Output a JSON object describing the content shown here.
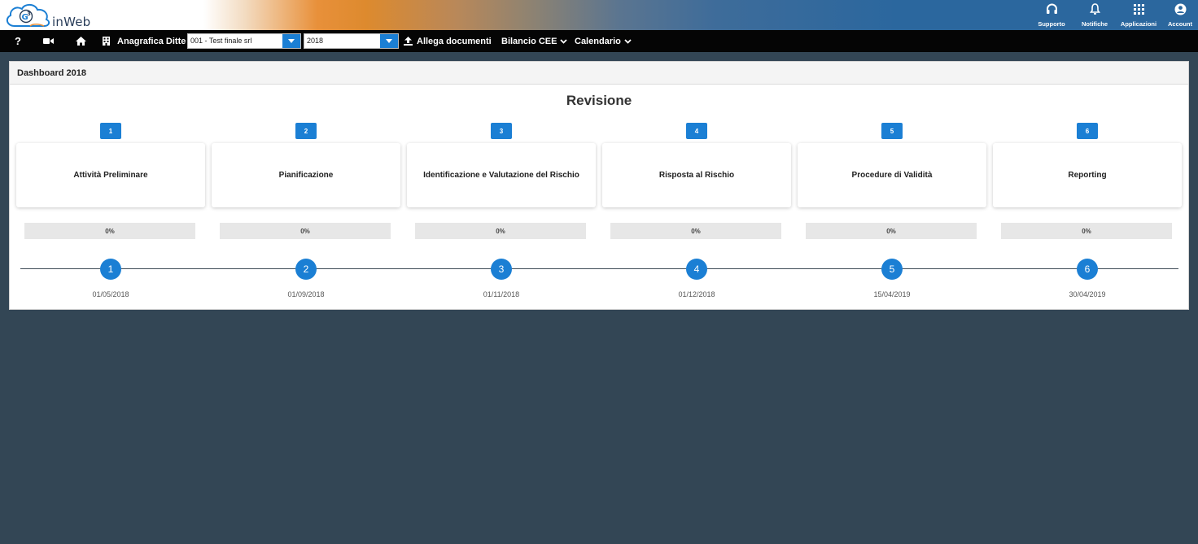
{
  "brand": {
    "name": "inWeb"
  },
  "top_actions": [
    {
      "label": "Supporto",
      "icon": "headset-icon"
    },
    {
      "label": "Notifiche",
      "icon": "bell-icon"
    },
    {
      "label": "Applicazioni",
      "icon": "grid-icon"
    },
    {
      "label": "Account",
      "icon": "user-circle-icon"
    }
  ],
  "nav": {
    "help_label": "?",
    "anagrafica_label": "Anagrafica Ditte",
    "company_select": "001 - Test finale srl",
    "year_select": "2018",
    "allega_label": "Allega documenti",
    "bilancio_label": "Bilancio CEE",
    "calendario_label": "Calendario"
  },
  "dashboard": {
    "header": "Dashboard 2018",
    "title": "Revisione",
    "steps": [
      {
        "number": "1",
        "title": "Attività Preliminare",
        "progress": "0%",
        "progress_value": 0,
        "date": "01/05/2018"
      },
      {
        "number": "2",
        "title": "Pianificazione",
        "progress": "0%",
        "progress_value": 0,
        "date": "01/09/2018"
      },
      {
        "number": "3",
        "title": "Identificazione e Valutazione del Rischio",
        "progress": "0%",
        "progress_value": 0,
        "date": "01/11/2018"
      },
      {
        "number": "4",
        "title": "Risposta al Rischio",
        "progress": "0%",
        "progress_value": 0,
        "date": "01/12/2018"
      },
      {
        "number": "5",
        "title": "Procedure di Validità",
        "progress": "0%",
        "progress_value": 0,
        "date": "15/04/2019"
      },
      {
        "number": "6",
        "title": "Reporting",
        "progress": "0%",
        "progress_value": 0,
        "date": "30/04/2019"
      }
    ]
  },
  "colors": {
    "accent": "#1b7fd4",
    "header_blue": "#2b679e",
    "header_orange": "#e8903a",
    "navbar": "#050505",
    "background": "#334655"
  }
}
